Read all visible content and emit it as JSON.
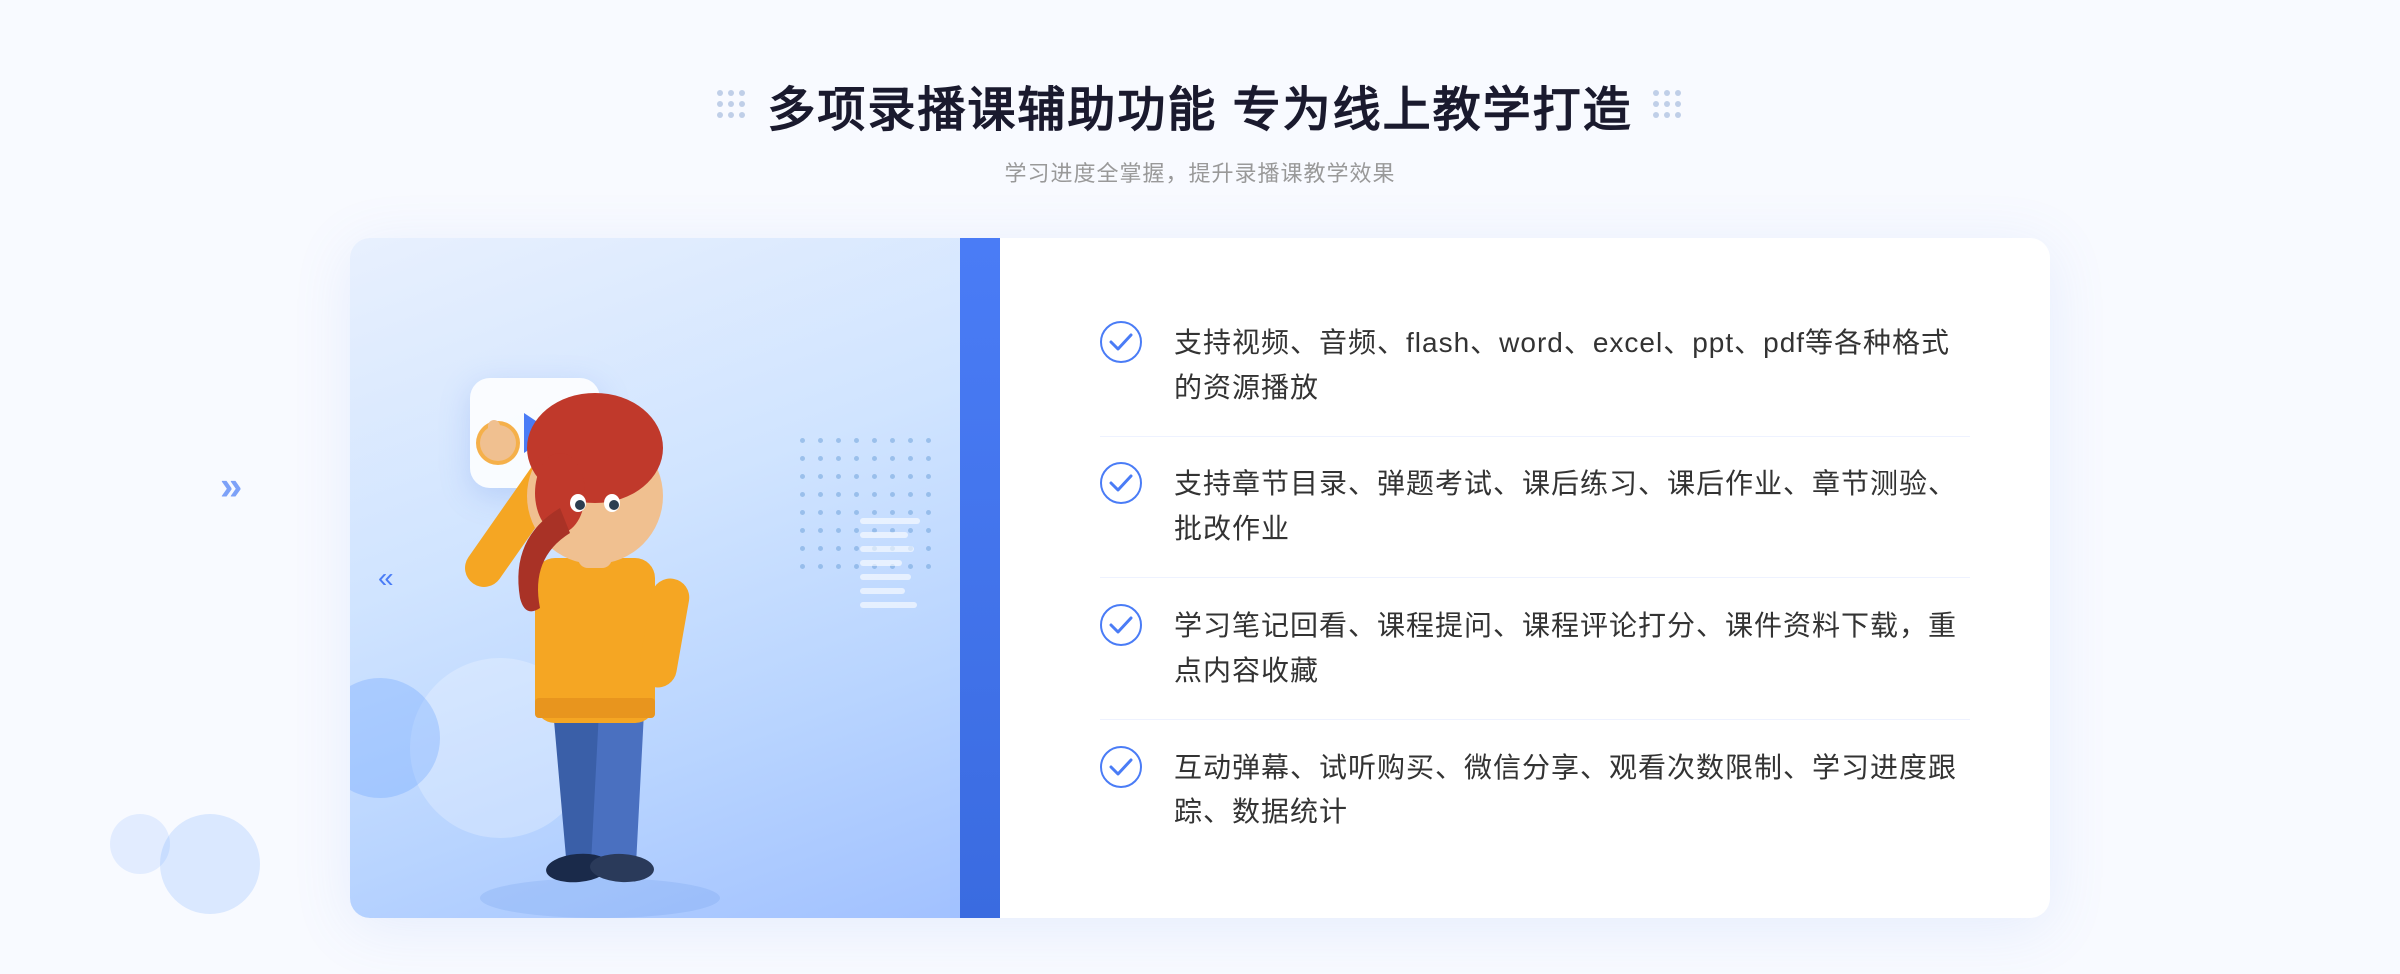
{
  "header": {
    "title": "多项录播课辅助功能 专为线上教学打造",
    "subtitle": "学习进度全掌握，提升录播课教学效果",
    "dots_icon_left": "grid-dots",
    "dots_icon_right": "grid-dots"
  },
  "features": [
    {
      "id": 1,
      "text": "支持视频、音频、flash、word、excel、ppt、pdf等各种格式的资源播放",
      "icon": "check-circle-icon"
    },
    {
      "id": 2,
      "text": "支持章节目录、弹题考试、课后练习、课后作业、章节测验、批改作业",
      "icon": "check-circle-icon"
    },
    {
      "id": 3,
      "text": "学习笔记回看、课程提问、课程评论打分、课件资料下载，重点内容收藏",
      "icon": "check-circle-icon"
    },
    {
      "id": 4,
      "text": "互动弹幕、试听购买、微信分享、观看次数限制、学习进度跟踪、数据统计",
      "icon": "check-circle-icon"
    }
  ],
  "illustration": {
    "play_button": "▶",
    "left_arrow": "«",
    "outside_arrow": "»"
  },
  "colors": {
    "primary_blue": "#4a7cf6",
    "light_blue_bg": "#d8e8ff",
    "text_dark": "#1a1a2e",
    "text_gray": "#999999",
    "text_body": "#333333"
  }
}
